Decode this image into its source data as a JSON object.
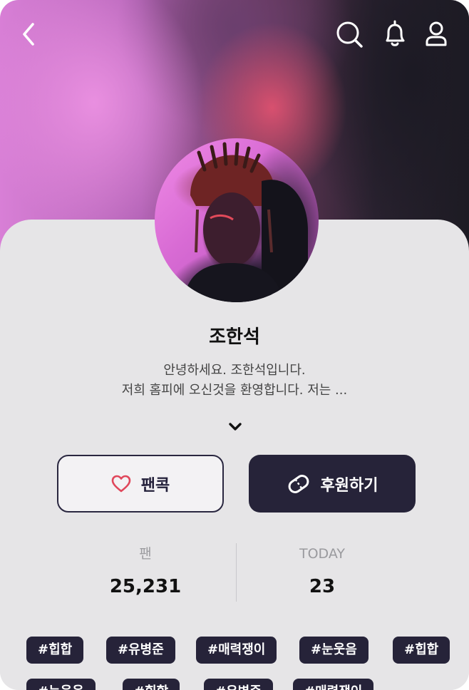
{
  "profile": {
    "name": "조한석",
    "bio_line1": "안녕하세요. 조한석입니다.",
    "bio_line2": "저희 홈피에 오신것을 환영합니다. 저는 ..."
  },
  "icons": {
    "back": "chevron-left-icon",
    "search": "search-icon",
    "notifications": "bell-icon",
    "account": "user-icon",
    "expand": "chevron-down-icon",
    "fan": "heart-icon",
    "support": "ticket-icon"
  },
  "actions": {
    "fan_label": "팬콕",
    "support_label": "후원하기"
  },
  "stats": {
    "fans_label": "팬",
    "fans_value": "25,231",
    "today_label": "TODAY",
    "today_value": "23"
  },
  "tags": [
    "#힙합",
    "#유병준",
    "#매력쟁이",
    "#눈웃음",
    "#힙합",
    "#눈웃음",
    "#힙합",
    "#유병준",
    "#매력쟁이"
  ],
  "colors": {
    "accent_dark": "#262339",
    "heart": "#e0475b",
    "panel_bg": "#e6e5e7"
  }
}
